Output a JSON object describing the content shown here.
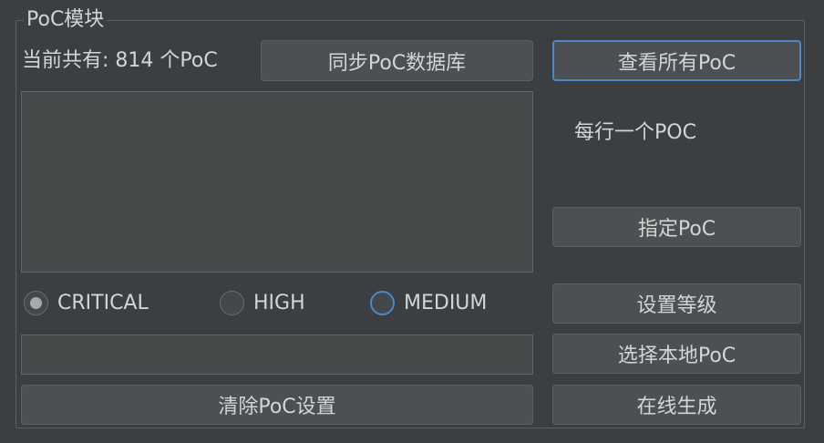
{
  "panel": {
    "title": "PoC模块"
  },
  "summary": {
    "text": "当前共有: 814 个PoC"
  },
  "buttons": {
    "sync_db": "同步PoC数据库",
    "view_all": "查看所有PoC",
    "specify": "指定PoC",
    "set_level": "设置等级",
    "choose_local": "选择本地PoC",
    "clear": "清除PoC设置",
    "generate_online": "在线生成"
  },
  "hint": {
    "text": "每行一个POC"
  },
  "poc_list": {
    "value": ""
  },
  "level_input": {
    "value": ""
  },
  "levels": [
    {
      "label": "CRITICAL",
      "selected": true
    },
    {
      "label": "HIGH",
      "selected": false
    },
    {
      "label": "MEDIUM",
      "selected": false
    }
  ],
  "colors": {
    "accent": "#4a88c7",
    "background": "#3c3f41",
    "button": "#4c5052"
  }
}
